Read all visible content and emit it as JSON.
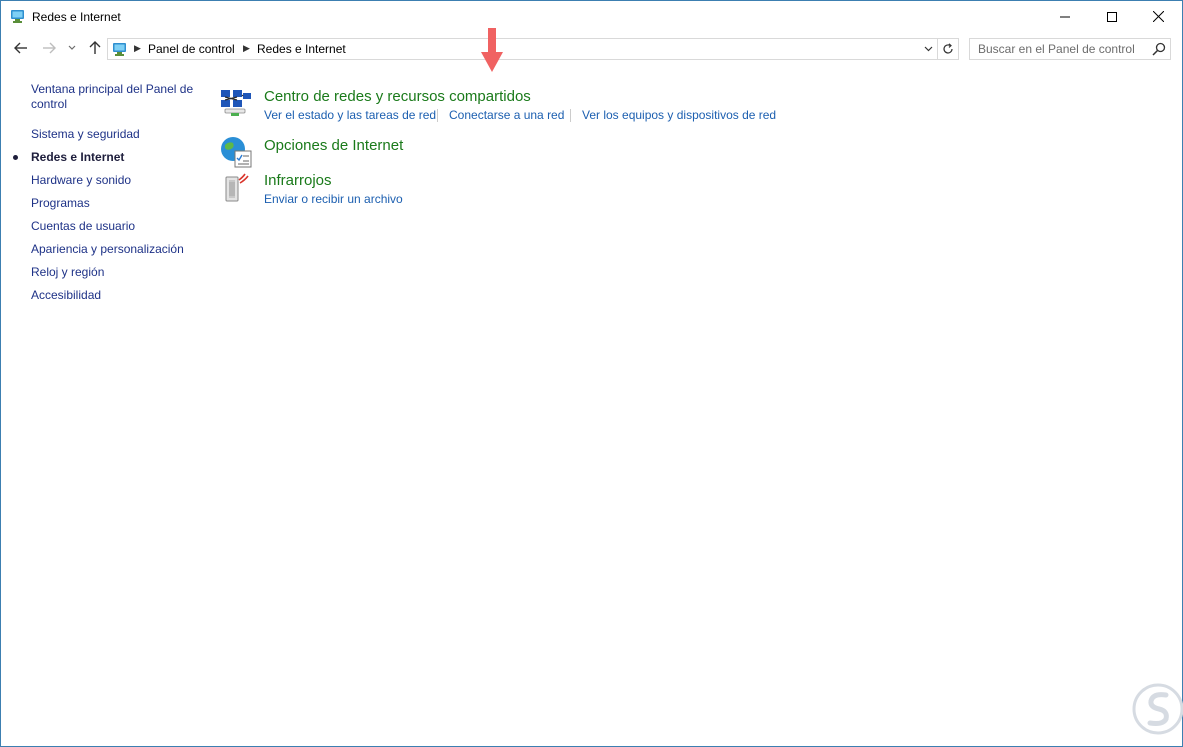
{
  "window": {
    "title": "Redes e Internet"
  },
  "address": {
    "crumbs": [
      "Panel de control",
      "Redes e Internet"
    ]
  },
  "search": {
    "placeholder": "Buscar en el Panel de control"
  },
  "sidebar": {
    "items": [
      {
        "label": "Ventana principal del Panel de control",
        "current": false
      },
      {
        "label": "Sistema y seguridad",
        "current": false
      },
      {
        "label": "Redes e Internet",
        "current": true
      },
      {
        "label": "Hardware y sonido",
        "current": false
      },
      {
        "label": "Programas",
        "current": false
      },
      {
        "label": "Cuentas de usuario",
        "current": false
      },
      {
        "label": "Apariencia y personalización",
        "current": false
      },
      {
        "label": "Reloj y región",
        "current": false
      },
      {
        "label": "Accesibilidad",
        "current": false
      }
    ]
  },
  "categories": [
    {
      "title": "Centro de redes y recursos compartidos",
      "icon": "network-center-icon",
      "links": [
        "Ver el estado y las tareas de red",
        "Conectarse a una red",
        "Ver los equipos y dispositivos de red"
      ]
    },
    {
      "title": "Opciones de Internet",
      "icon": "internet-options-icon",
      "links": []
    },
    {
      "title": "Infrarrojos",
      "icon": "infrared-icon",
      "links": [
        "Enviar o recibir un archivo"
      ]
    }
  ],
  "colors": {
    "category_title": "#1a7a1a",
    "link": "#1c5fb0",
    "sidebar_link": "#1e3287",
    "arrow": "#f06262",
    "window_border": "#3c7fb1"
  }
}
